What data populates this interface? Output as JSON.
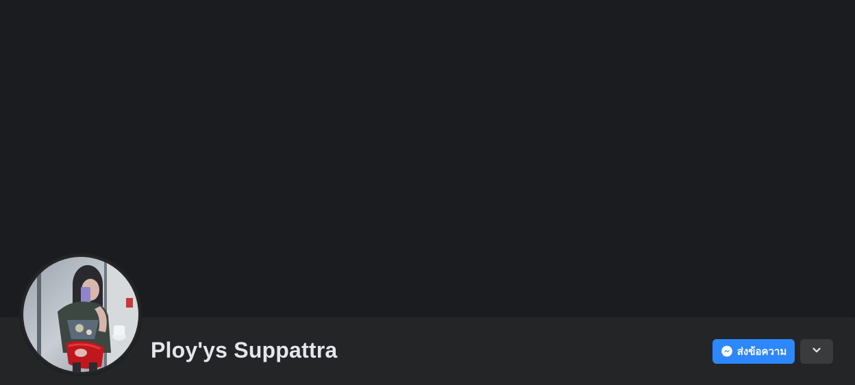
{
  "profile": {
    "name": "Ploy'ys Suppattra",
    "avatar_icon": "profile-photo"
  },
  "actions": {
    "message_label": "ส่งข้อความ",
    "message_icon": "messenger-icon",
    "more_icon": "chevron-down-icon"
  },
  "colors": {
    "background": "#18191a",
    "cover": "#1b1c1f",
    "profile_bar": "#242526",
    "primary_button": "#2d88ff",
    "secondary_button": "#3a3b3c",
    "name_text": "#e4e6eb"
  }
}
